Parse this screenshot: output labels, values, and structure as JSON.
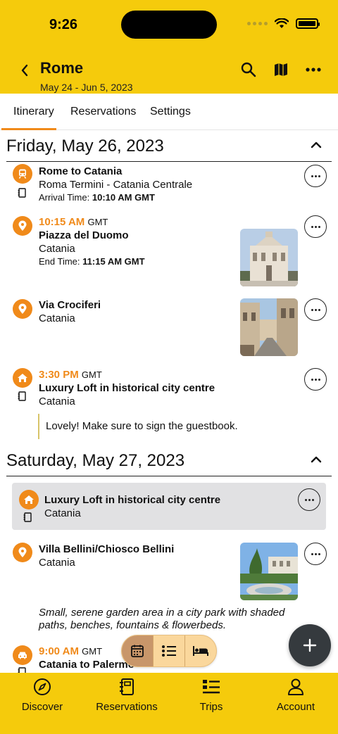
{
  "status": {
    "time": "9:26"
  },
  "header": {
    "title": "Rome",
    "dates": "May 24 - Jun 5, 2023"
  },
  "tabs": [
    "Itinerary",
    "Reservations",
    "Settings"
  ],
  "days": [
    {
      "label": "Friday, May 26, 2023",
      "items": [
        {
          "title": "Rome to Catania",
          "sub": "Roma Termini - Catania Centrale",
          "detail_label": "Arrival Time:",
          "detail_value": "10:10 AM GMT"
        },
        {
          "time": "10:15 AM",
          "tz": "GMT",
          "title": "Piazza del Duomo",
          "sub": "Catania",
          "detail_label": "End Time:",
          "detail_value": "11:15 AM GMT"
        },
        {
          "title": "Via Crociferi",
          "sub": "Catania"
        },
        {
          "time": "3:30 PM",
          "tz": "GMT",
          "title": "Luxury Loft in historical city centre",
          "sub": "Catania",
          "note": "Lovely! Make sure to sign the guestbook."
        }
      ]
    },
    {
      "label": "Saturday, May 27, 2023",
      "items": [
        {
          "title": "Luxury Loft in historical city centre",
          "sub": "Catania"
        },
        {
          "title": "Villa Bellini/Chiosco Bellini",
          "sub": "Catania",
          "description": "Small, serene garden area in a city park with shaded paths, benches, fountains & flowerbeds."
        },
        {
          "time": "9:00 AM",
          "tz": "GMT",
          "title": "Catania to Palermo"
        }
      ]
    }
  ],
  "bottom_nav": [
    "Discover",
    "Reservations",
    "Trips",
    "Account"
  ],
  "colors": {
    "brand": "#f5cb0c",
    "accent": "#f08a1a"
  }
}
